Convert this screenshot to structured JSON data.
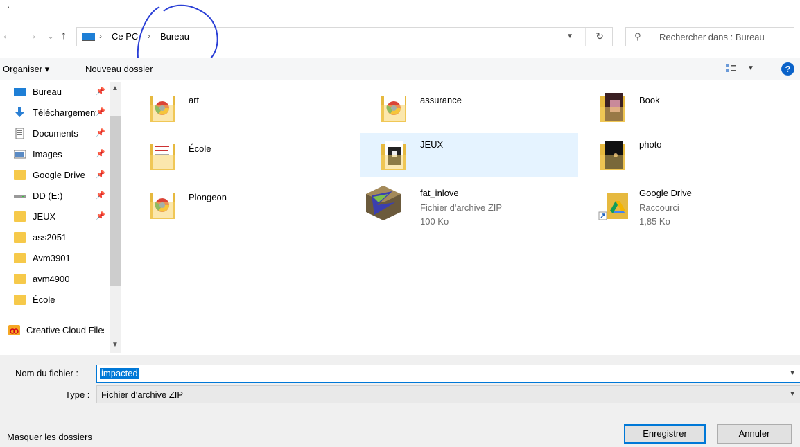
{
  "window": {
    "menu_fragment": "·"
  },
  "navigation": {
    "back": "←",
    "forward": "→",
    "recent": "⌄",
    "up": "↑",
    "breadcrumb": [
      "Ce PC",
      "Bureau"
    ],
    "refresh": "↻"
  },
  "search": {
    "placeholder": "Rechercher dans : Bureau"
  },
  "command_bar": {
    "organize": "Organiser ▾",
    "new_folder": "Nouveau dossier",
    "help": "?"
  },
  "sidebar": {
    "items": [
      {
        "label": "Bureau",
        "icon": "desktop-icon",
        "pinned": true
      },
      {
        "label": "Téléchargements",
        "icon": "download-icon",
        "pinned": true
      },
      {
        "label": "Documents",
        "icon": "documents-icon",
        "pinned": true
      },
      {
        "label": "Images",
        "icon": "images-icon",
        "pinned": true
      },
      {
        "label": "Google Drive",
        "icon": "folder-icon",
        "pinned": true
      },
      {
        "label": "DD (E:)",
        "icon": "drive-icon",
        "pinned": true
      },
      {
        "label": "JEUX",
        "icon": "folder-icon",
        "pinned": true
      },
      {
        "label": "ass2051",
        "icon": "folder-icon",
        "pinned": false
      },
      {
        "label": "Avm3901",
        "icon": "folder-icon",
        "pinned": false
      },
      {
        "label": "avm4900",
        "icon": "folder-icon",
        "pinned": false
      },
      {
        "label": "École",
        "icon": "folder-icon",
        "pinned": false
      },
      {
        "label": "Creative Cloud Files",
        "icon": "creative-cloud-icon",
        "pinned": false
      }
    ]
  },
  "files": [
    {
      "name": "art",
      "kind": "folder"
    },
    {
      "name": "assurance",
      "kind": "folder"
    },
    {
      "name": "Book",
      "kind": "folder"
    },
    {
      "name": "École",
      "kind": "folder"
    },
    {
      "name": "JEUX",
      "kind": "folder",
      "selected": true
    },
    {
      "name": "photo",
      "kind": "folder"
    },
    {
      "name": "Plongeon",
      "kind": "folder"
    },
    {
      "name": "fat_inlove",
      "kind": "zip",
      "type": "Fichier d'archive ZIP",
      "size": "100 Ko"
    },
    {
      "name": "Google Drive",
      "kind": "shortcut",
      "type": "Raccourci",
      "size": "1,85 Ko"
    }
  ],
  "form": {
    "filename_label": "Nom du fichier :",
    "filename_value": "impacted",
    "type_label": "Type :",
    "type_value": "Fichier d'archive ZIP",
    "hide_folders": "Masquer les dossiers",
    "save": "Enregistrer",
    "cancel": "Annuler"
  },
  "colors": {
    "accent": "#0078d7",
    "folder": "#f6c94a",
    "selection": "#e5f3ff",
    "annotation": "#2a3fd6"
  }
}
